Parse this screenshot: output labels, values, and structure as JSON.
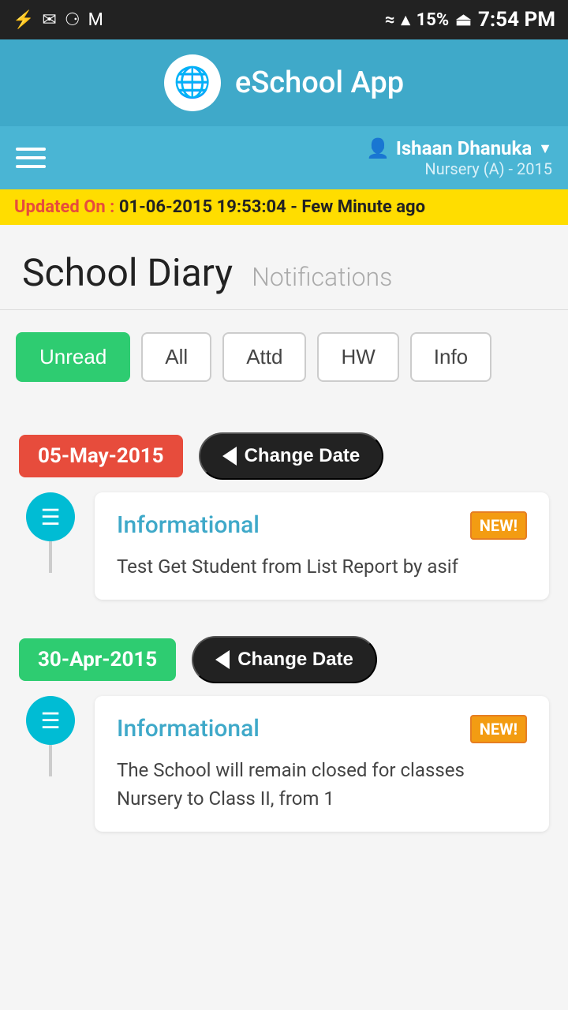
{
  "statusBar": {
    "leftIcons": [
      "usb-icon",
      "mail-icon",
      "image-icon",
      "gmail-icon"
    ],
    "rightIcons": [
      "wifi-icon",
      "signal-icon"
    ],
    "battery": "15%",
    "time": "7:54 PM"
  },
  "header": {
    "appName": "eSchool App"
  },
  "nav": {
    "userName": "Ishaan Dhanuka",
    "userClass": "Nursery (A) - 2015"
  },
  "updateBar": {
    "label": "Updated On :",
    "value": "01-06-2015 19:53:04 - Few Minute ago"
  },
  "pageTitle": "School Diary",
  "pageSubtitle": "Notifications",
  "filterTabs": [
    {
      "id": "unread",
      "label": "Unread",
      "active": true
    },
    {
      "id": "all",
      "label": "All",
      "active": false
    },
    {
      "id": "attd",
      "label": "Attd",
      "active": false
    },
    {
      "id": "hw",
      "label": "HW",
      "active": false
    },
    {
      "id": "info",
      "label": "Info",
      "active": false
    }
  ],
  "entries": [
    {
      "date": "05-May-2015",
      "dateColor": "red",
      "changeDateLabel": "Change Date",
      "type": "Informational",
      "isNew": true,
      "newBadge": "NEW!",
      "text": "Test Get Student from List Report by asif"
    },
    {
      "date": "30-Apr-2015",
      "dateColor": "green",
      "changeDateLabel": "Change Date",
      "type": "Informational",
      "isNew": true,
      "newBadge": "NEW!",
      "text": "The School will remain closed for classes Nursery to Class II, from 1"
    }
  ]
}
